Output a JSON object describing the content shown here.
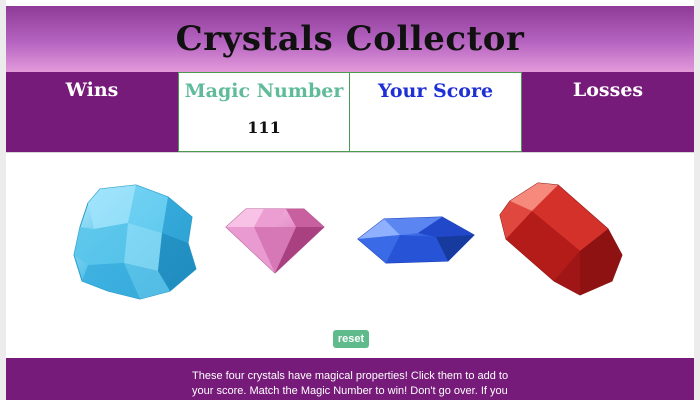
{
  "header": {
    "title": "Crystals Collector"
  },
  "scoreboard": {
    "wins": {
      "label": "Wins",
      "value": ""
    },
    "magic_number": {
      "label": "Magic Number",
      "value": "111"
    },
    "your_score": {
      "label": "Your Score",
      "value": ""
    },
    "losses": {
      "label": "Losses",
      "value": ""
    }
  },
  "crystals": [
    {
      "icon": "blue-crystal-cluster-icon",
      "color": "#4bbde6"
    },
    {
      "icon": "pink-diamond-icon",
      "color": "#e58fc8"
    },
    {
      "icon": "blue-gem-icon",
      "color": "#2e5fe0"
    },
    {
      "icon": "red-crystal-icon",
      "color": "#c8231f"
    }
  ],
  "controls": {
    "reset_label": "reset"
  },
  "footer": {
    "instructions": "These four crystals have magical properties! Click them to add to your score. Match the Magic Number to win! Don't go over. If you"
  },
  "colors": {
    "purple": "#761b79",
    "header_gradient_end": "#e29ad9",
    "green": "#5fbb8c",
    "blue": "#1f2fd6"
  }
}
